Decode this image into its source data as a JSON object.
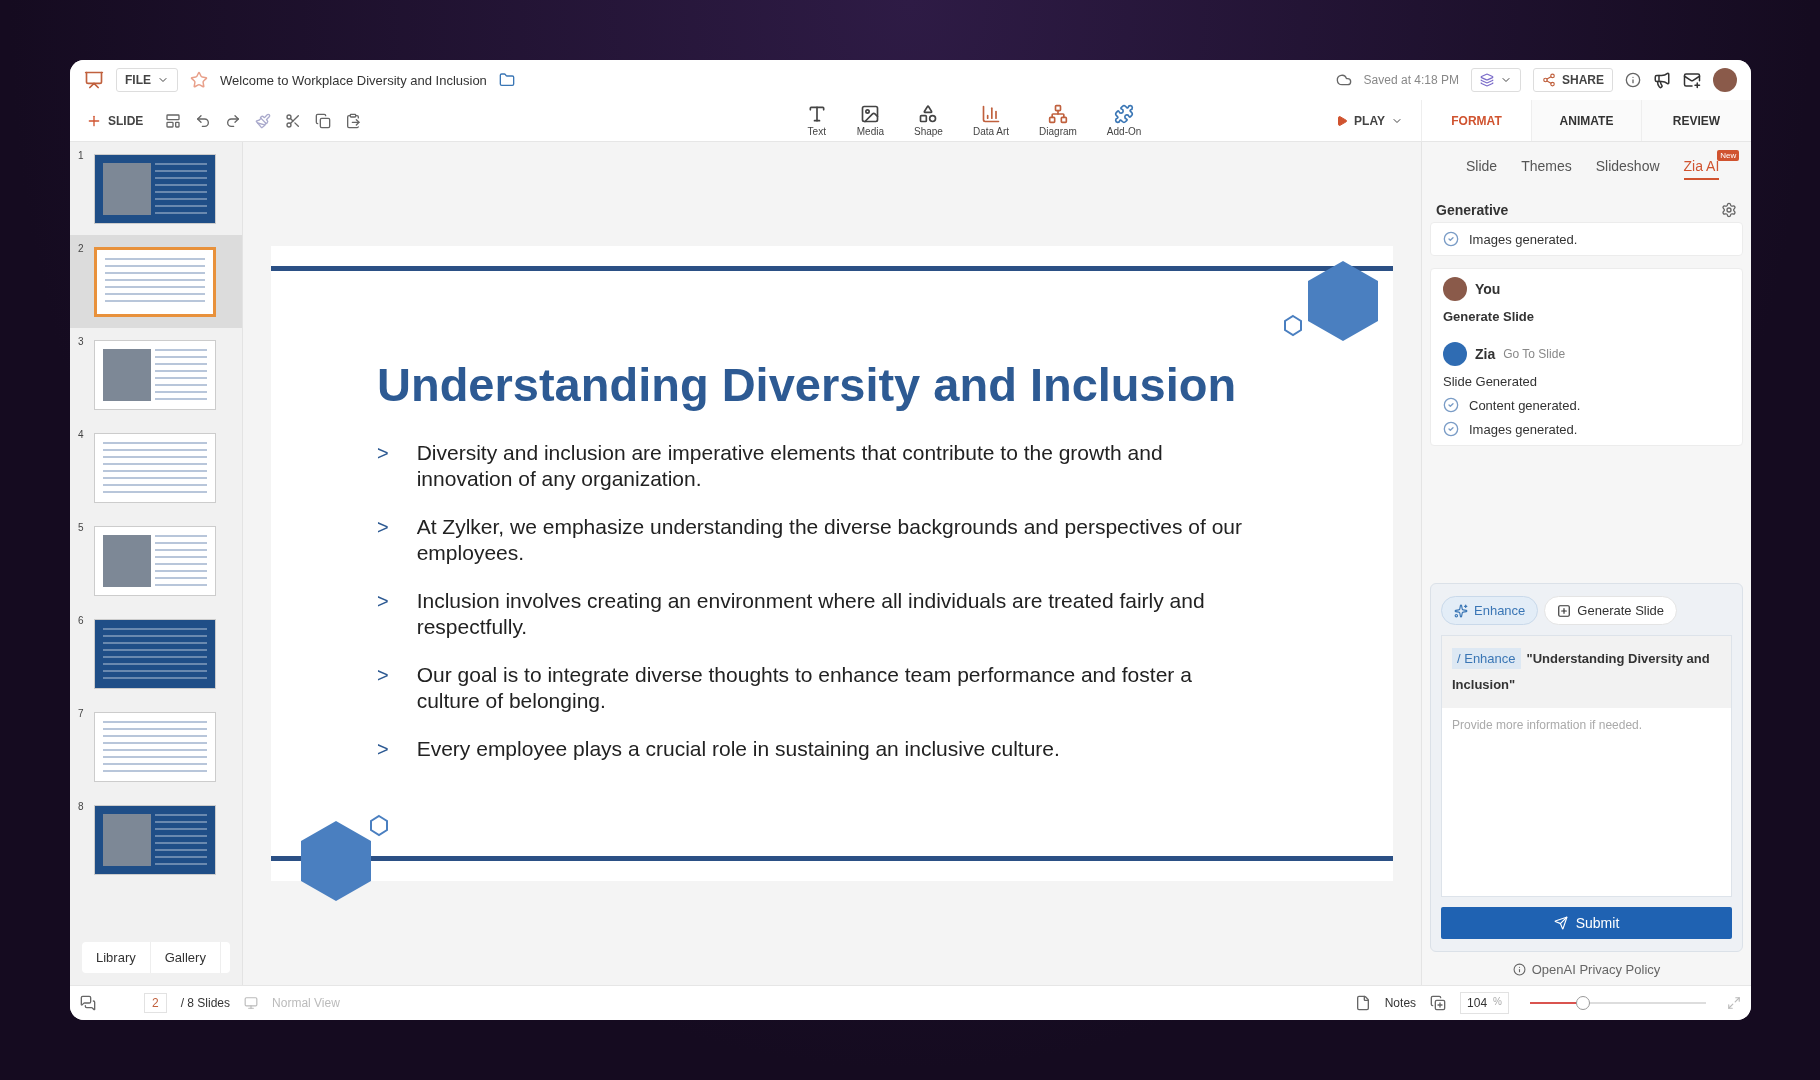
{
  "app_bar": {
    "file_menu": "FILE",
    "document_title": "Welcome to Workplace Diversity and Inclusion",
    "save_status": "Saved at 4:18 PM",
    "share": "SHARE"
  },
  "toolbar": {
    "new_slide": "SLIDE",
    "insert_tools": [
      {
        "kind": "text",
        "label": "Text"
      },
      {
        "kind": "media",
        "label": "Media"
      },
      {
        "kind": "shape",
        "label": "Shape"
      },
      {
        "kind": "dataart",
        "label": "Data Art"
      },
      {
        "kind": "diagram",
        "label": "Diagram"
      },
      {
        "kind": "addon",
        "label": "Add-On"
      }
    ],
    "play": "PLAY"
  },
  "panel_tabs": [
    {
      "label": "FORMAT",
      "selected": true
    },
    {
      "label": "ANIMATE",
      "selected": false
    },
    {
      "label": "REVIEW",
      "selected": false
    }
  ],
  "sub_tabs": [
    {
      "label": "Slide",
      "selected": false
    },
    {
      "label": "Themes",
      "selected": false
    },
    {
      "label": "Slideshow",
      "selected": false
    },
    {
      "label": "Zia AI",
      "selected": true,
      "badge": "New"
    }
  ],
  "slides": [
    {
      "number": "1",
      "selected": false,
      "dark": true,
      "photo": true
    },
    {
      "number": "2",
      "selected": true,
      "dark": false,
      "photo": false
    },
    {
      "number": "3",
      "selected": false,
      "dark": false,
      "photo": true
    },
    {
      "number": "4",
      "selected": false,
      "dark": false,
      "photo": false
    },
    {
      "number": "5",
      "selected": false,
      "dark": false,
      "photo": true
    },
    {
      "number": "6",
      "selected": false,
      "dark": true,
      "photo": false
    },
    {
      "number": "7",
      "selected": false,
      "dark": false,
      "photo": false
    },
    {
      "number": "8",
      "selected": false,
      "dark": true,
      "photo": true
    }
  ],
  "library_tabs": [
    "Library",
    "Gallery"
  ],
  "slide": {
    "title": "Understanding Diversity and Inclusion",
    "bullets": [
      {
        "marker": ">",
        "text": "Diversity and inclusion are imperative elements that contribute to the growth and innovation of any organization."
      },
      {
        "marker": ">",
        "text": "At Zylker, we emphasize understanding the diverse backgrounds and perspectives of our employees."
      },
      {
        "marker": ">",
        "text": "Inclusion involves creating an environment where all individuals are treated fairly and respectfully."
      },
      {
        "marker": ">",
        "text": "Our goal is to integrate diverse thoughts to enhance team performance and foster a culture of belonging."
      },
      {
        "marker": ">",
        "text": "Every employee plays a crucial role in sustaining an inclusive culture."
      }
    ]
  },
  "zia_panel": {
    "heading": "Generative",
    "previous_steps": [
      "Images generated."
    ],
    "conversation": {
      "user": "You",
      "request": "Generate Slide",
      "assistant": "Zia",
      "link": "Go To Slide",
      "result": "Slide Generated",
      "steps": [
        "Content generated.",
        "Images generated."
      ]
    },
    "actions": [
      {
        "kind": "enhance",
        "label": "Enhance",
        "selected": true
      },
      {
        "kind": "generate",
        "label": "Generate Slide",
        "selected": false
      }
    ],
    "prompt": {
      "command": "/ Enhance",
      "text": "\"Understanding Diversity and Inclusion\"",
      "placeholder": "Provide more information if needed."
    },
    "submit": "Submit",
    "privacy_link": "OpenAI Privacy Policy"
  },
  "status_bar": {
    "current_slide": "2",
    "slide_count": "/ 8 Slides",
    "view": "Normal View",
    "notes": "Notes",
    "zoom": "104",
    "zoom_unit": "%",
    "level": 0.3
  }
}
